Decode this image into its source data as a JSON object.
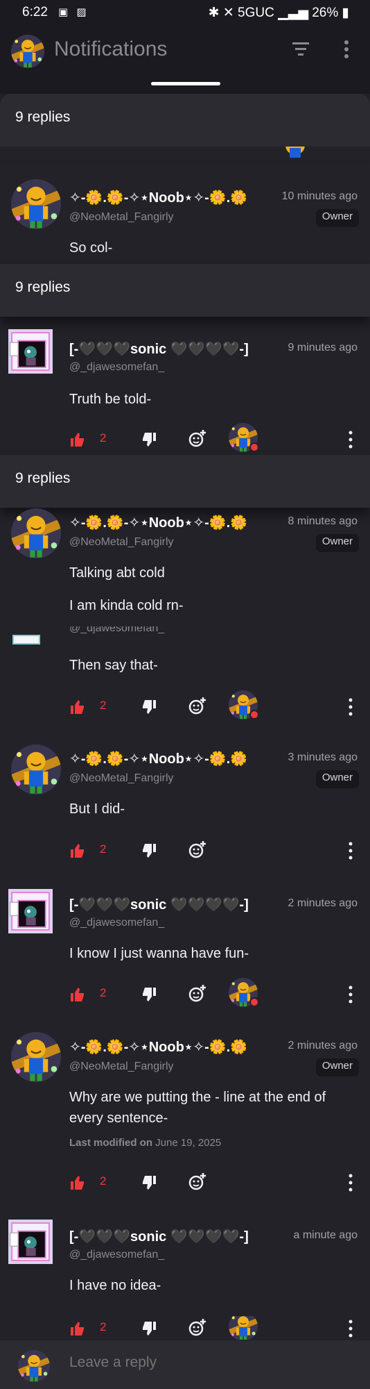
{
  "status": {
    "time": "6:22",
    "network": "5GUC",
    "battery": "26%"
  },
  "header": {
    "title": "Notifications"
  },
  "banners": [
    "9 replies",
    "9 replies",
    "9 replies"
  ],
  "comments": [
    {
      "name": "✧-🌼.🌼-✧⋆Noob⋆✧-🌼.🌼",
      "handle": "@NeoMetal_Fangirly",
      "time": "10 minutes ago",
      "badge": "Owner",
      "text": "So col-"
    },
    {
      "name": "[-🖤🖤🖤sonic 🖤🖤🖤🖤-]",
      "handle": "@_djawesomefan_",
      "time": "9 minutes ago",
      "text": "Truth be told-",
      "likes": "2"
    },
    {
      "name": "✧-🌼.🌼-✧⋆Noob⋆✧-🌼.🌼",
      "handle": "@NeoMetal_Fangirly",
      "time": "8 minutes ago",
      "badge": "Owner",
      "text": "Talking abt cold",
      "text2": "I am kinda cold rn-"
    },
    {
      "handle": "@_djawesomefan_",
      "text": "Then say that-",
      "likes": "2"
    },
    {
      "name": "✧-🌼.🌼-✧⋆Noob⋆✧-🌼.🌼",
      "handle": "@NeoMetal_Fangirly",
      "time": "3 minutes ago",
      "badge": "Owner",
      "text": "But I did-",
      "likes": "2"
    },
    {
      "name": "[-🖤🖤🖤sonic 🖤🖤🖤🖤-]",
      "handle": "@_djawesomefan_",
      "time": "2 minutes ago",
      "text": "I know I just wanna have fun-",
      "likes": "2"
    },
    {
      "name": "✧-🌼.🌼-✧⋆Noob⋆✧-🌼.🌼",
      "handle": "@NeoMetal_Fangirly",
      "time": "2 minutes ago",
      "badge": "Owner",
      "text": "Why are we putting the - line at the end of every sentence-",
      "modified_label": "Last modified on",
      "modified_date": "June 19, 2025",
      "likes": "2"
    },
    {
      "name": "[-🖤🖤🖤sonic 🖤🖤🖤🖤-]",
      "handle": "@_djawesomefan_",
      "time": "a minute ago",
      "text": "I have no idea-",
      "likes": "2"
    }
  ],
  "reply": {
    "placeholder": "Leave a reply"
  },
  "colors": {
    "background": "#232229",
    "banner": "#2c2b31",
    "accent_red": "#ef3a3a"
  },
  "icons": [
    "filter-icon",
    "more-vertical-icon",
    "thumbs-up-icon",
    "thumbs-down-icon",
    "add-reaction-icon",
    "heart-icon"
  ]
}
